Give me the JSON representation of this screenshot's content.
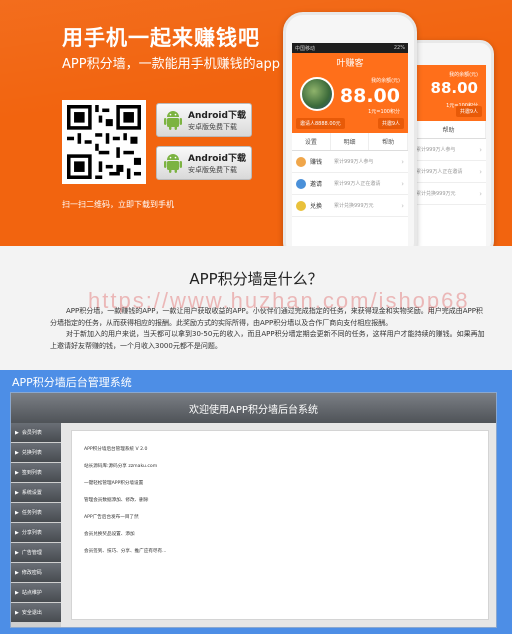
{
  "banner": {
    "title": "用手机一起来赚钱吧",
    "subtitle": "APP积分墙，一款能用手机赚钱的app",
    "download_buttons": [
      {
        "label": "Android下载",
        "sub": "安卓版免费下载"
      },
      {
        "label": "Android下载",
        "sub": "安卓版免费下载"
      }
    ],
    "scan_text": "扫一扫二维码，立即下载到手机",
    "phone": {
      "status_left": "中国移动",
      "status_right": "22%",
      "app_title": "叶赚客",
      "balance_label": "我的余额(元)",
      "balance": "88.00",
      "rate": "1元=100积分",
      "chips": [
        "邀请人8888.00元",
        "共邀9人"
      ],
      "tabs": [
        "设置",
        "明细",
        "帮助"
      ],
      "rows": [
        {
          "name": "赚钱",
          "desc": "累计999万人参与"
        },
        {
          "name": "邀请",
          "desc": "累计99万人正在邀请"
        },
        {
          "name": "兑换",
          "desc": "累计兑换999万元"
        }
      ]
    },
    "phone2": {
      "balance_label": "我的余额(元)",
      "balance": "88.00",
      "rate": "1元=100积分",
      "chip": "共邀9人",
      "tab": "帮助",
      "rows": [
        "累计999万人参与",
        "累计99万人正在邀请",
        "累计兑换999万元"
      ]
    },
    "colors": {
      "brand": "#f2640f",
      "accent": "#ff6f1a"
    }
  },
  "intro": {
    "title": "APP积分墙是什么？",
    "paragraph1": "APP积分墙，一款赚钱的APP，一款让用户获取收益的APP。小伙伴们通过完成指定的任务，来获得现金和实物奖励。用户完成由APP积分墙指定的任务，从而获得相应的报酬。此奖励方式的实际所得，由APP积分墙以及合作厂商向支付相应报酬。",
    "paragraph2": "对于新加入的用户来说，当天都可以拿到30-50元的收入，而且APP积分墙定期会更新不同的任务，这样用户才能持续的赚钱。如果再加上邀请好友帮赚的钱，一个月收入3000元都不是问题。",
    "watermark": "https://www.huzhan.com/ishop68"
  },
  "admin": {
    "title": "APP积分墙后台管理系统",
    "welcome": "欢迎使用APP积分墙后台系统",
    "sidebar": [
      "会员列表",
      "兑换列表",
      "签到列表",
      "系统设置",
      "任务列表",
      "分享列表",
      "广告管理",
      "修改密码",
      "站点维护",
      "安全退出"
    ],
    "main_lines": [
      "APP积分墙后台管理系统 V 2.0",
      "站长源码库:源码分享 zzmaku.com",
      "一键轻松管理APP积分墙设置",
      "管理会员数据添加、修改、删除",
      "APP广告后台发布一目了然",
      "会员兑换奖品设置、添加",
      "会员签到、技巧、分享、推广应有尽有..."
    ],
    "colors": {
      "header_bg": "#4d8ee6"
    }
  }
}
